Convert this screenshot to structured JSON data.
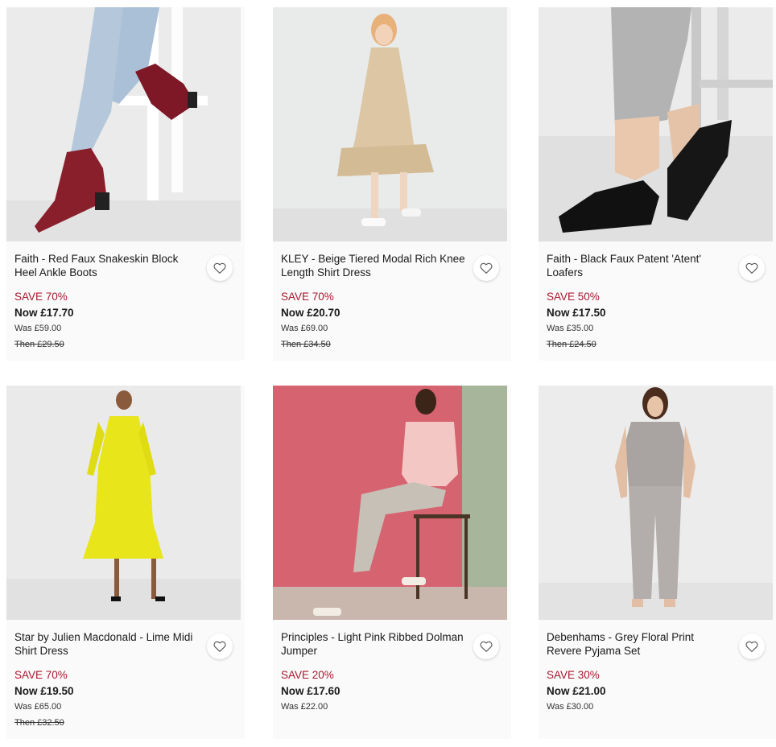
{
  "accent_sale_color": "#a6192e",
  "products": [
    {
      "title": "Faith - Red Faux Snakeskin Block Heel Ankle Boots",
      "save": "SAVE 70%",
      "now": "Now £17.70",
      "was": "Was £59.00",
      "then": "Then £29.50",
      "image": "red-snakeskin-ankle-boots-photo",
      "wishlist_icon": "heart-outline-icon"
    },
    {
      "title": "KLEY - Beige Tiered Modal Rich Knee Length Shirt Dress",
      "save": "SAVE 70%",
      "now": "Now £20.70",
      "was": "Was £69.00",
      "then": "Then £34.50",
      "image": "beige-tiered-shirt-dress-photo",
      "wishlist_icon": "heart-outline-icon"
    },
    {
      "title": "Faith - Black Faux Patent 'Atent' Loafers",
      "save": "SAVE 50%",
      "now": "Now £17.50",
      "was": "Was £35.00",
      "then": "Then £24.50",
      "image": "black-patent-loafers-photo",
      "wishlist_icon": "heart-outline-icon"
    },
    {
      "title": "Star by Julien Macdonald - Lime Midi Shirt Dress",
      "save": "SAVE 70%",
      "now": "Now £19.50",
      "was": "Was £65.00",
      "then": "Then £32.50",
      "image": "lime-midi-shirt-dress-photo",
      "wishlist_icon": "heart-outline-icon"
    },
    {
      "title": "Principles - Light Pink Ribbed Dolman Jumper",
      "save": "SAVE 20%",
      "now": "Now £17.60",
      "was": "Was £22.00",
      "then": "",
      "image": "light-pink-dolman-jumper-photo",
      "wishlist_icon": "heart-outline-icon"
    },
    {
      "title": "Debenhams - Grey Floral Print Revere Pyjama Set",
      "save": "SAVE 30%",
      "now": "Now £21.00",
      "was": "Was £30.00",
      "then": "",
      "image": "grey-floral-pyjama-set-photo",
      "wishlist_icon": "heart-outline-icon"
    }
  ]
}
